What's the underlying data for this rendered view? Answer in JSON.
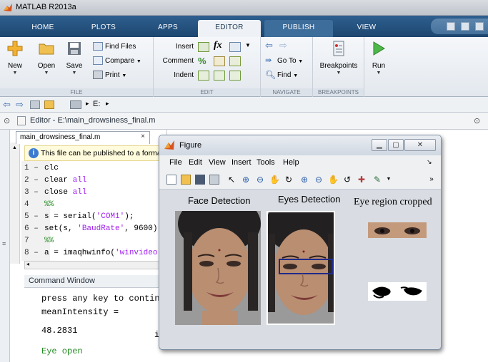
{
  "app": {
    "title": "MATLAB R2013a"
  },
  "tabs": [
    "HOME",
    "PLOTS",
    "APPS",
    "EDITOR",
    "PUBLISH",
    "VIEW"
  ],
  "ribbon": {
    "file": {
      "label": "FILE",
      "new": "New",
      "open": "Open",
      "save": "Save",
      "find_files": "Find Files",
      "compare": "Compare",
      "print": "Print"
    },
    "edit": {
      "label": "EDIT",
      "insert": "Insert",
      "comment": "Comment",
      "indent": "Indent",
      "fx": "fx"
    },
    "navigate": {
      "label": "NAVIGATE",
      "goto": "Go To",
      "find": "Find"
    },
    "breakpoints": {
      "label": "BREAKPOINTS",
      "btn": "Breakpoints"
    },
    "run": {
      "label": "Run"
    }
  },
  "pathbar": {
    "drive": "E:"
  },
  "editor": {
    "title": "Editor - E:\\main_drowsiness_final.m",
    "file_tab": "main_drowsiness_final.m",
    "info": "This file can be published to a formatted document.",
    "lines": [
      {
        "n": "1",
        "mark": "–",
        "parts": [
          [
            "",
            "clc"
          ]
        ]
      },
      {
        "n": "2",
        "mark": "–",
        "parts": [
          [
            "",
            "clear "
          ],
          [
            "kw",
            "all"
          ]
        ]
      },
      {
        "n": "3",
        "mark": "–",
        "parts": [
          [
            "",
            "close "
          ],
          [
            "kw",
            "all"
          ]
        ]
      },
      {
        "n": "4",
        "mark": "",
        "parts": [
          [
            "cm",
            "%%"
          ]
        ]
      },
      {
        "n": "5",
        "mark": "–",
        "parts": [
          [
            "",
            "  s = serial("
          ],
          [
            "st",
            "'COM1'"
          ],
          [
            "",
            ");"
          ]
        ]
      },
      {
        "n": "6",
        "mark": "–",
        "parts": [
          [
            "",
            "set(s, "
          ],
          [
            "st",
            "'BaudRate'"
          ],
          [
            "",
            ", 9600);"
          ]
        ]
      },
      {
        "n": "7",
        "mark": "",
        "parts": [
          [
            "cm",
            "%%"
          ]
        ]
      },
      {
        "n": "8",
        "mark": "–",
        "parts": [
          [
            "",
            "a = imaqhwinfo("
          ],
          [
            "st",
            "'winvideo'"
          ],
          [
            "",
            ");"
          ]
        ]
      }
    ]
  },
  "command_window": {
    "title": "Command Window",
    "lines": [
      "press any key to continue",
      "meanIntensity =",
      "",
      "   48.2831",
      "",
      "   Eye open"
    ],
    "partial_right": "i"
  },
  "figure": {
    "title": "Figure",
    "menu": [
      "File",
      "Edit",
      "View",
      "Insert",
      "Tools",
      "Help"
    ],
    "axes_titles": [
      "Face Detection",
      "Eyes Detection",
      "Eye region cropped"
    ]
  },
  "colors": {
    "ribbon_blue": "#1d4670",
    "eye_box": "#1f2a8a",
    "code_keyword": "#a020f0",
    "code_comment": "#228b22"
  }
}
